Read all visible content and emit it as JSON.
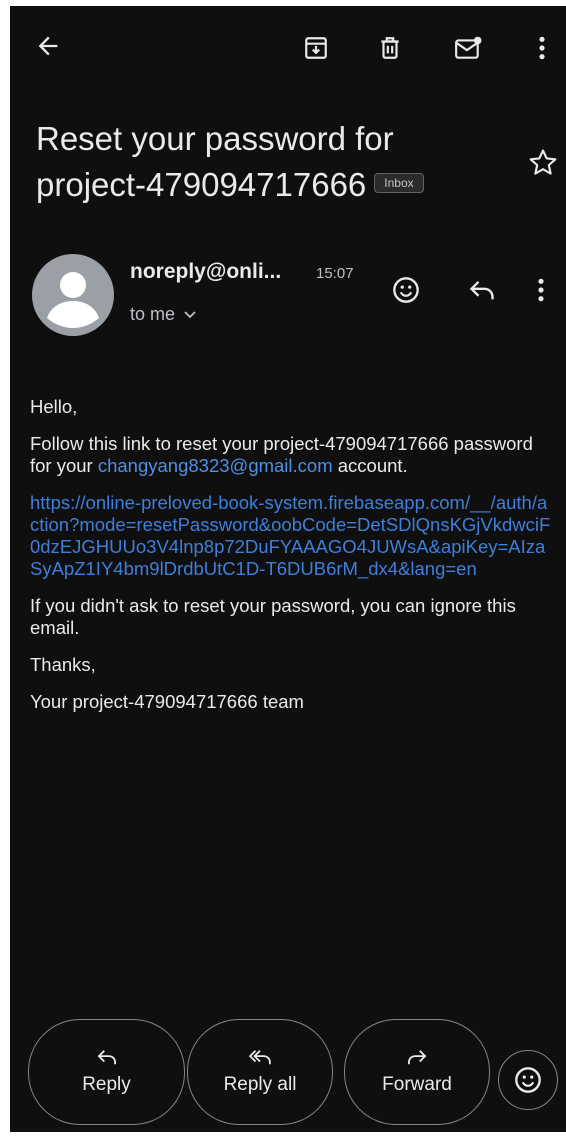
{
  "toolbar": {
    "back_icon": "arrow-back-icon",
    "archive_icon": "archive-icon",
    "delete_icon": "trash-icon",
    "mark_unread_icon": "mark-unread-icon",
    "more_icon": "more-vert-icon"
  },
  "email": {
    "subject": "Reset your password for project-479094717666",
    "label": "Inbox",
    "sender": "noreply@onli...",
    "time": "15:07",
    "recipient": "to me",
    "greeting": "Hello,",
    "intro_prefix": "Follow this link to reset your project-479094717666 password for your ",
    "intro_email": "changyang8323@gmail.com",
    "intro_suffix": " account.",
    "reset_link": "https://online-preloved-book-system.firebaseapp.com/__/auth/action?mode=resetPassword&oobCode=DetSDlQnsKGjVkdwciF0dzEJGHUUo3V4lnp8p72DuFYAAAGO4JUWsA&apiKey=AIzaSyApZ1IY4bm9lDrdbUtC1D-T6DUB6rM_dx4&lang=en",
    "ignore_note": "If you didn't ask to reset your password, you can ignore this email.",
    "thanks": "Thanks,",
    "signature": "Your project-479094717666 team"
  },
  "actions": {
    "reply": "Reply",
    "reply_all": "Reply all",
    "forward": "Forward"
  },
  "colors": {
    "background": "#0f0f0f",
    "text": "#e8eaed",
    "link": "#4f8fe6",
    "avatar": "#9aa0a6"
  }
}
